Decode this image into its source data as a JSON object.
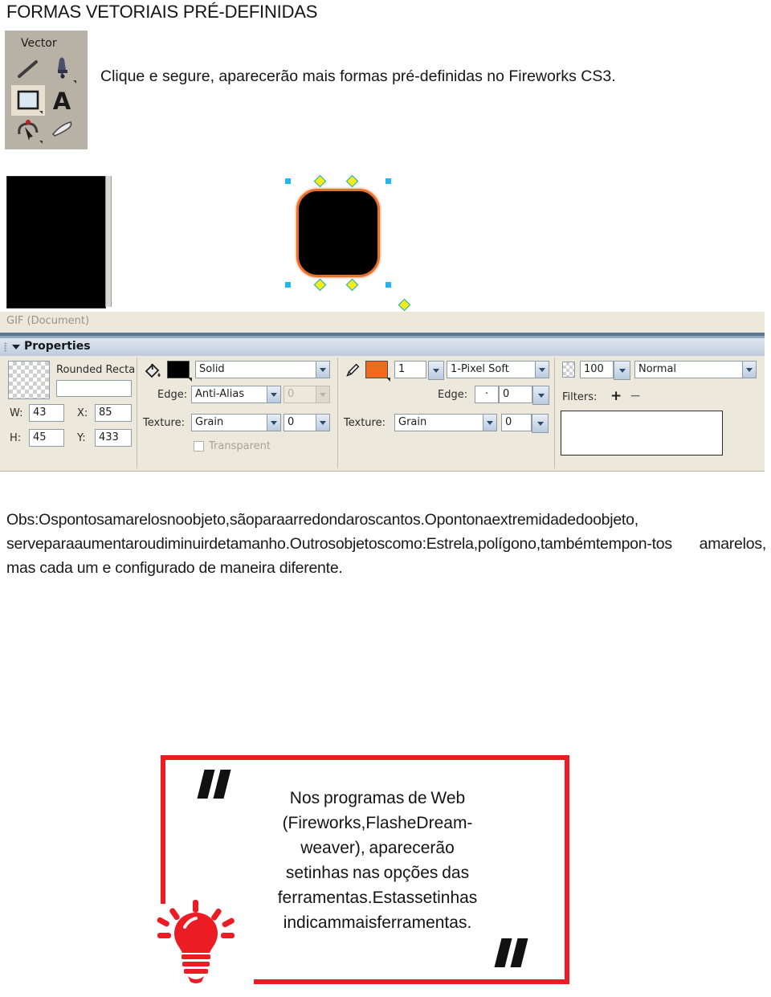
{
  "page": {
    "title": "FORMAS VETORIAIS PRÉ-DEFINIDAS",
    "intro": "Clique e segure, aparecerão mais formas pré-definidas no Fireworks CS3."
  },
  "vector_palette": {
    "title": "Vector",
    "tools": [
      {
        "name": "line-tool",
        "icon": "line-icon",
        "selected": false,
        "has_flyout": false
      },
      {
        "name": "pen-tool",
        "icon": "pen-icon",
        "selected": false,
        "has_flyout": true
      },
      {
        "name": "rectangle-tool",
        "icon": "rectangle-icon",
        "selected": true,
        "has_flyout": true
      },
      {
        "name": "text-tool",
        "icon": "text-a-icon",
        "selected": false,
        "has_flyout": false
      },
      {
        "name": "freeform-tool",
        "icon": "freeform-path-icon",
        "selected": false,
        "has_flyout": true
      },
      {
        "name": "knife-tool",
        "icon": "knife-icon",
        "selected": false,
        "has_flyout": false
      }
    ]
  },
  "canvas": {
    "document_swatch": "#000000",
    "shape": {
      "name": "rounded-rectangle",
      "fill": "#000000",
      "stroke": "#e8702a",
      "selection_handle_color": "#24b7ee",
      "radius_handle_color": "#f2ec1a"
    }
  },
  "fireworks": {
    "statusbar": {
      "label": "GIF (Document)"
    },
    "properties": {
      "panel_title": "Properties",
      "object_type": "Rounded Recta",
      "object_name_value": "",
      "dimensions": {
        "w_label": "W:",
        "w_value": "43",
        "h_label": "H:",
        "h_value": "45",
        "x_label": "X:",
        "x_value": "85",
        "y_label": "Y:",
        "y_value": "433"
      },
      "fill": {
        "icon": "paint-bucket-icon",
        "color": "#000000",
        "type": "Solid",
        "edge_label": "Edge:",
        "edge_value": "Anti-Alias",
        "edge_amount": "0",
        "texture_label": "Texture:",
        "texture_value": "Grain",
        "texture_amount": "0",
        "transparent_label": "Transparent",
        "transparent_checked": false
      },
      "stroke": {
        "icon": "pencil-icon",
        "color": "#ef6c1f",
        "tip_size": "1",
        "stroke_type": "1-Pixel Soft",
        "edge_label": "Edge:",
        "edge_dot": "·",
        "edge_value": "0",
        "texture_label": "Texture:",
        "texture_value": "Grain",
        "texture_amount": "0"
      },
      "appearance": {
        "opacity_icon": "opacity-checker-icon",
        "opacity": "100",
        "blend_mode": "Normal",
        "filters_label": "Filters:",
        "add_filter_icon": "plus-icon",
        "remove_filter_icon": "minus-icon",
        "filters_list": ""
      }
    }
  },
  "obs": {
    "tight": "Obs:Ospontosamarelosnoobjeto,sãoparaarredondaroscantos.Opontonaextremidadedoobjeto, serveparaaumentaroudiminuirdetamanho.Outrosobjetoscomo:Estrela,polígono,tambémtempon-tos ",
    "loose": "amarelos, mas cada um e configurado de maneira diferente."
  },
  "callout": {
    "border_color": "#ec1c24",
    "bulb_icon": "lightbulb-icon",
    "quote_open_icon": "quote-open-icon",
    "quote_close_icon": "quote-close-icon",
    "line1": "Nos programas de Web",
    "line2": "(Fireworks,FlasheDream-",
    "line3": "weaver), aparecerão",
    "line4": "setinhas nas opções das",
    "line5": "ferramentas.Estassetinhas",
    "line6": "indicammaisferramentas."
  }
}
